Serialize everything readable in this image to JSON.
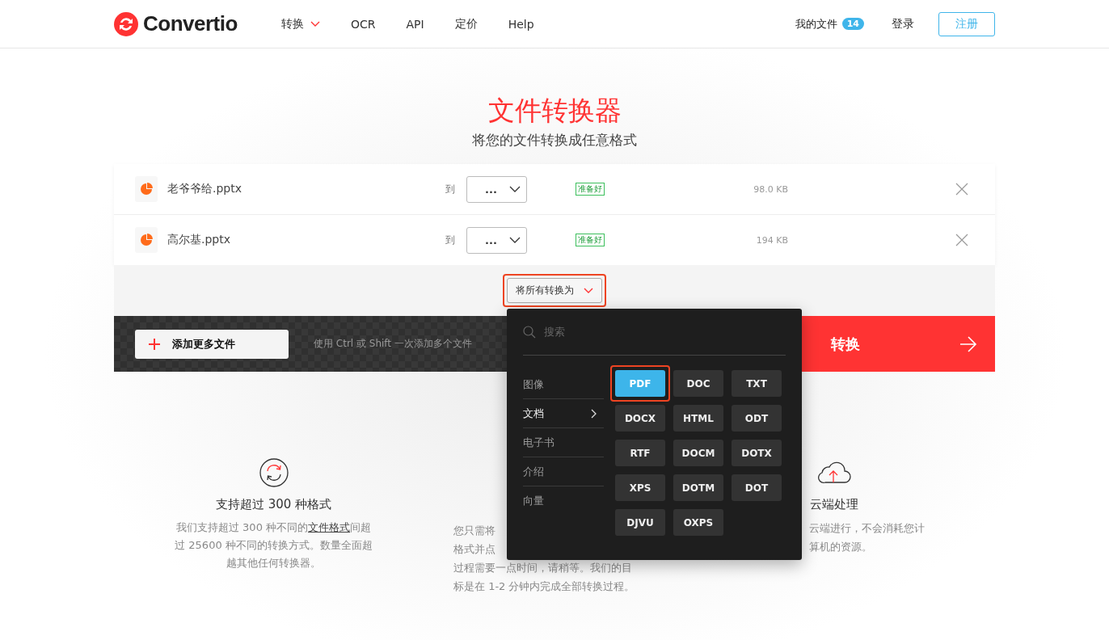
{
  "header": {
    "logo": "Convertio",
    "nav": [
      {
        "label": "转换",
        "has_menu": true
      },
      {
        "label": "OCR",
        "has_menu": false
      },
      {
        "label": "API",
        "has_menu": false
      },
      {
        "label": "定价",
        "has_menu": false
      },
      {
        "label": "Help",
        "has_menu": false
      }
    ],
    "my_files": "我的文件",
    "files_count": "14",
    "login": "登录",
    "signup": "注册"
  },
  "hero": {
    "title": "文件转换器",
    "subtitle": "将您的文件转换成任意格式"
  },
  "files": [
    {
      "name": "老爷爷给.pptx",
      "to_label": "到",
      "format": "...",
      "status": "准备好",
      "size": "98.0 KB"
    },
    {
      "name": "高尔基.pptx",
      "to_label": "到",
      "format": "...",
      "status": "准备好",
      "size": "194 KB"
    }
  ],
  "convert_all": {
    "label": "将所有转换为",
    "highlighted": true
  },
  "toolbar": {
    "add_more": "添加更多文件",
    "hint": "使用 Ctrl 或 Shift 一次添加多个文件",
    "convert": "转换"
  },
  "dropdown": {
    "search_placeholder": "搜索",
    "categories": [
      {
        "label": "图像",
        "selected": false
      },
      {
        "label": "文档",
        "selected": true
      },
      {
        "label": "电子书",
        "selected": false
      },
      {
        "label": "介绍",
        "selected": false
      },
      {
        "label": "向量",
        "selected": false
      }
    ],
    "formats": [
      {
        "label": "PDF",
        "selected": true,
        "highlighted": true
      },
      {
        "label": "DOC",
        "selected": false,
        "highlighted": false
      },
      {
        "label": "TXT",
        "selected": false,
        "highlighted": false
      },
      {
        "label": "DOCX",
        "selected": false,
        "highlighted": false
      },
      {
        "label": "HTML",
        "selected": false,
        "highlighted": false
      },
      {
        "label": "ODT",
        "selected": false,
        "highlighted": false
      },
      {
        "label": "RTF",
        "selected": false,
        "highlighted": false
      },
      {
        "label": "DOCM",
        "selected": false,
        "highlighted": false
      },
      {
        "label": "DOTX",
        "selected": false,
        "highlighted": false
      },
      {
        "label": "XPS",
        "selected": false,
        "highlighted": false
      },
      {
        "label": "DOTM",
        "selected": false,
        "highlighted": false
      },
      {
        "label": "DOT",
        "selected": false,
        "highlighted": false
      },
      {
        "label": "DJVU",
        "selected": false,
        "highlighted": false
      },
      {
        "label": "OXPS",
        "selected": false,
        "highlighted": false
      }
    ]
  },
  "features": [
    {
      "kind": "paragraph",
      "title": "支持超过 300 种格式",
      "text_before": "我们支持超过 300 种不同的",
      "link": "文件格式",
      "text_after": "间超过 25600 种不同的转换方式。数量全面超越其他任何转换器。"
    },
    {
      "kind": "lines",
      "lines": [
        "您只需将",
        "格式并点",
        "过程需要一点时间，请稍等。我们的目",
        "标是在 1-2 分钟内完成全部转换过程。"
      ]
    },
    {
      "kind": "lines",
      "title": "云端处理",
      "lines": [
        "云端进行，不会消耗您计",
        "算机的资源。"
      ]
    }
  ]
}
